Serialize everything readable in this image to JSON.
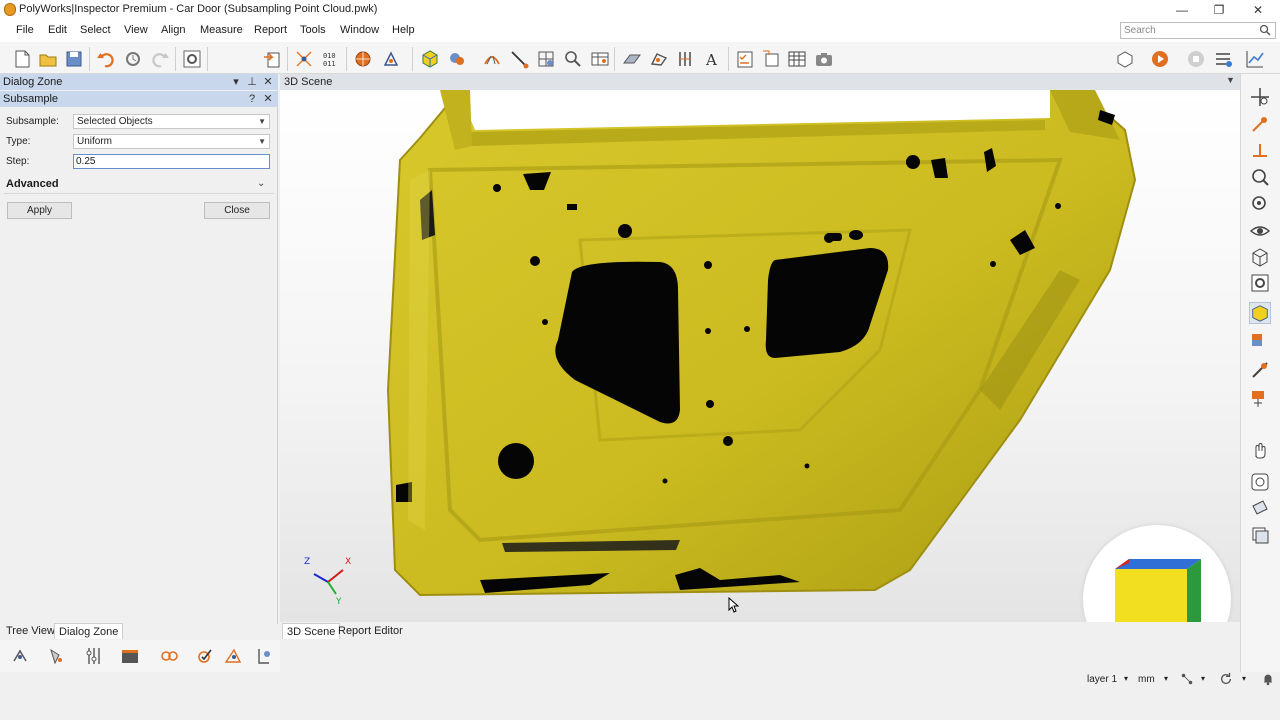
{
  "window": {
    "title": "PolyWorks|Inspector Premium - Car Door (Subsampling Point Cloud.pwk)",
    "controls": {
      "minimize": "—",
      "maximize": "❐",
      "close": "✕"
    }
  },
  "menu": [
    "File",
    "Edit",
    "Select",
    "View",
    "Align",
    "Measure",
    "Report",
    "Tools",
    "Window",
    "Help"
  ],
  "search": {
    "placeholder": "Search"
  },
  "dialog_zone": {
    "title": "Dialog Zone",
    "pin": "⊥",
    "close": "✕",
    "subpanel": {
      "title": "Subsample",
      "help": "?",
      "close": "✕",
      "fields": [
        {
          "label": "Subsample:",
          "value": "Selected Objects"
        },
        {
          "label": "Type:",
          "value": "Uniform"
        },
        {
          "label": "Step:",
          "value": "0.25"
        }
      ],
      "advanced": "Advanced",
      "apply": "Apply",
      "close_button": "Close"
    }
  },
  "left_tabs": [
    "Tree View",
    "Dialog Zone"
  ],
  "scene": {
    "title": "3D Scene",
    "axes": {
      "z": "Z",
      "x": "X",
      "y": "Y"
    },
    "colors": {
      "part": "#d4c42a",
      "hole": "#050505",
      "background": "#f2f2f2"
    }
  },
  "bottom_tabs": [
    "3D Scene",
    "Report Editor"
  ],
  "status": {
    "layer": "layer 1",
    "units": "mm"
  },
  "colors": {
    "accent": "#3a7bd5",
    "panel_header": "#c8d7ec"
  }
}
